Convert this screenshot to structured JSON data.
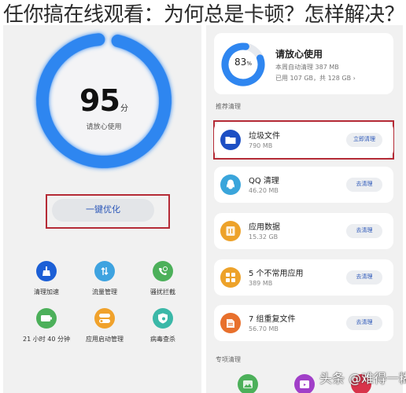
{
  "headline": "任你搞在线观看：为何总是卡顿？怎样解决？",
  "left_panel": {
    "score": {
      "value": "95",
      "unit": "分",
      "caption": "请放心使用",
      "fraction": 0.95,
      "color": "#2f86f0"
    },
    "optimize_button": "一键优化",
    "tools": [
      {
        "label": "清理加速",
        "icon": "broom-icon",
        "color": "#1c5fd6"
      },
      {
        "label": "流量管理",
        "icon": "data-arrows-icon",
        "color": "#3ea3e0"
      },
      {
        "label": "骚扰拦截",
        "icon": "phone-block-icon",
        "color": "#4cb05a"
      },
      {
        "label": "21 小时 40 分钟",
        "icon": "battery-icon",
        "color": "#4cb05a"
      },
      {
        "label": "应用启动管理",
        "icon": "toggle-icon",
        "color": "#f0a22c"
      },
      {
        "label": "病毒查杀",
        "icon": "shield-scan-icon",
        "color": "#3bb8a8"
      }
    ]
  },
  "right_panel": {
    "storage": {
      "percent": "83",
      "percent_unit": "%",
      "fraction": 0.83,
      "title": "请放心使用",
      "weekly_clean": "本周自动清理 387 MB",
      "usage": "已用 107 GB，共 128 GB",
      "chevron": "›"
    },
    "recommended_label": "推荐清理",
    "items": [
      {
        "name": "垃圾文件",
        "size": "790 MB",
        "button": "立即清理",
        "icon": "folder-icon",
        "color": "#1c4fc4"
      },
      {
        "name": "QQ 清理",
        "size": "46.20 MB",
        "button": "去清理",
        "icon": "qq-icon",
        "color": "#3aa5db"
      },
      {
        "name": "应用数据",
        "size": "15.32 GB",
        "button": "去清理",
        "icon": "app-data-icon",
        "color": "#eda22a"
      },
      {
        "name": "5 个不常用应用",
        "size": "389 MB",
        "button": "去清理",
        "icon": "apps-grid-icon",
        "color": "#eda22a"
      },
      {
        "name": "7 组重复文件",
        "size": "56.70 MB",
        "button": "去清理",
        "icon": "duplicate-file-icon",
        "color": "#e8702c"
      }
    ],
    "special_label": "专项清理",
    "special_icons": [
      {
        "icon": "image-icon",
        "color": "#4cb05a"
      },
      {
        "icon": "video-icon",
        "color": "#a13fc8"
      },
      {
        "icon": "music-icon",
        "color": "#d8334a"
      }
    ]
  },
  "watermark": "头条 @难得一糊"
}
